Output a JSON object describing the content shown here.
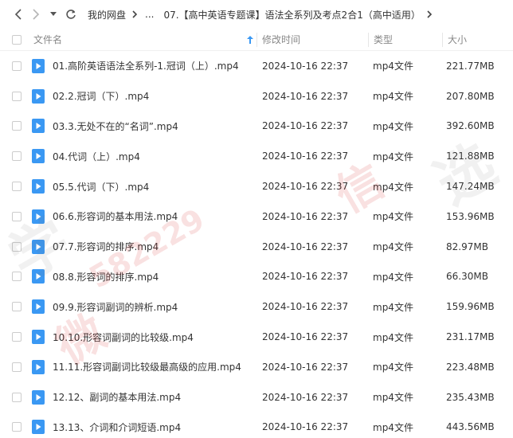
{
  "nav": {
    "back_icon": "chevron-left-icon",
    "forward_icon": "chevron-right-icon",
    "history_icon": "caret-down-icon",
    "refresh_icon": "refresh-icon",
    "breadcrumb": {
      "root": "我的网盘",
      "ellipsis": "...",
      "current": "07.【高中英语专题课】语法全系列及考点2合1（高中适用）"
    }
  },
  "columns": {
    "name": "文件名",
    "modified": "修改时间",
    "type": "类型",
    "size": "大小",
    "sort_icon": "sort-up-arrow-icon"
  },
  "files": [
    {
      "name": "01.高阶英语语法全系列-1.冠词（上）.mp4",
      "modified": "2024-10-16 22:37",
      "type": "mp4文件",
      "size": "221.77MB"
    },
    {
      "name": "02.2.冠词（下）.mp4",
      "modified": "2024-10-16 22:37",
      "type": "mp4文件",
      "size": "207.80MB"
    },
    {
      "name": "03.3.无处不在的“名词”.mp4",
      "modified": "2024-10-16 22:37",
      "type": "mp4文件",
      "size": "392.60MB"
    },
    {
      "name": "04.代词（上）.mp4",
      "modified": "2024-10-16 22:37",
      "type": "mp4文件",
      "size": "121.88MB"
    },
    {
      "name": "05.5.代词（下）.mp4",
      "modified": "2024-10-16 22:37",
      "type": "mp4文件",
      "size": "147.24MB"
    },
    {
      "name": "06.6.形容词的基本用法.mp4",
      "modified": "2024-10-16 22:37",
      "type": "mp4文件",
      "size": "153.96MB"
    },
    {
      "name": "07.7.形容词的排序.mp4",
      "modified": "2024-10-16 22:37",
      "type": "mp4文件",
      "size": "82.97MB"
    },
    {
      "name": "08.8.形容词的排序.mp4",
      "modified": "2024-10-16 22:37",
      "type": "mp4文件",
      "size": "66.30MB"
    },
    {
      "name": "09.9.形容词副词的辨析.mp4",
      "modified": "2024-10-16 22:37",
      "type": "mp4文件",
      "size": "159.96MB"
    },
    {
      "name": "10.10.形容词副词的比较级.mp4",
      "modified": "2024-10-16 22:37",
      "type": "mp4文件",
      "size": "231.17MB"
    },
    {
      "name": "11.11.形容词副词比较级最高级的应用.mp4",
      "modified": "2024-10-16 22:37",
      "type": "mp4文件",
      "size": "223.48MB"
    },
    {
      "name": "12.12、副词的基本用法.mp4",
      "modified": "2024-10-16 22:37",
      "type": "mp4文件",
      "size": "235.43MB"
    },
    {
      "name": "13.13、介词和介词短语.mp4",
      "modified": "2024-10-16 22:37",
      "type": "mp4文件",
      "size": "443.56MB"
    }
  ],
  "file_icon": "video-file-icon",
  "watermark": {
    "chars": [
      "学",
      "微",
      "信",
      "选"
    ],
    "number": "582229"
  },
  "colors": {
    "accent": "#3a98f3",
    "text": "#333333",
    "header_text": "#888888",
    "watermark_red": "#d22828"
  }
}
